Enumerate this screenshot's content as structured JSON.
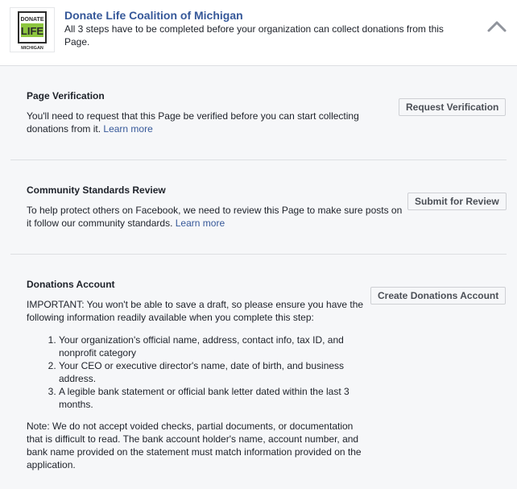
{
  "header": {
    "org_name": "Donate Life Coalition of Michigan",
    "subtitle": "All 3 steps have to be completed before your organization can collect donations from this Page.",
    "logo": {
      "line1": "DONATE",
      "line2": "LIFE",
      "line3": "MICHIGAN",
      "accent_color": "#8dc63f"
    },
    "collapse_icon": "chevron-up-icon"
  },
  "sections": [
    {
      "title": "Page Verification",
      "body": "You'll need to request that this Page be verified before you can start collecting donations from it.",
      "link": "Learn more",
      "button": "Request Verification"
    },
    {
      "title": "Community Standards Review",
      "body": "To help protect others on Facebook, we need to review this Page to make sure posts on it follow our community standards.",
      "link": "Learn more",
      "button": "Submit for Review"
    },
    {
      "title": "Donations Account",
      "body": "IMPORTANT: You won't be able to save a draft, so please ensure you have the following information readily available when you complete this step:",
      "steps": [
        "Your organization's official name, address, contact info, tax ID, and nonprofit category",
        "Your CEO or executive director's name, date of birth, and business address.",
        "A legible bank statement or official bank letter dated within the last 3 months."
      ],
      "note": "Note: We do not accept voided checks, partial documents, or documentation that is difficult to read. The bank account holder's name, account number, and bank name provided on the statement must match information provided on the application.",
      "button": "Create Donations Account"
    }
  ],
  "colors": {
    "link": "#365899",
    "background": "#f6f7f9",
    "divider": "#dddfe2"
  }
}
